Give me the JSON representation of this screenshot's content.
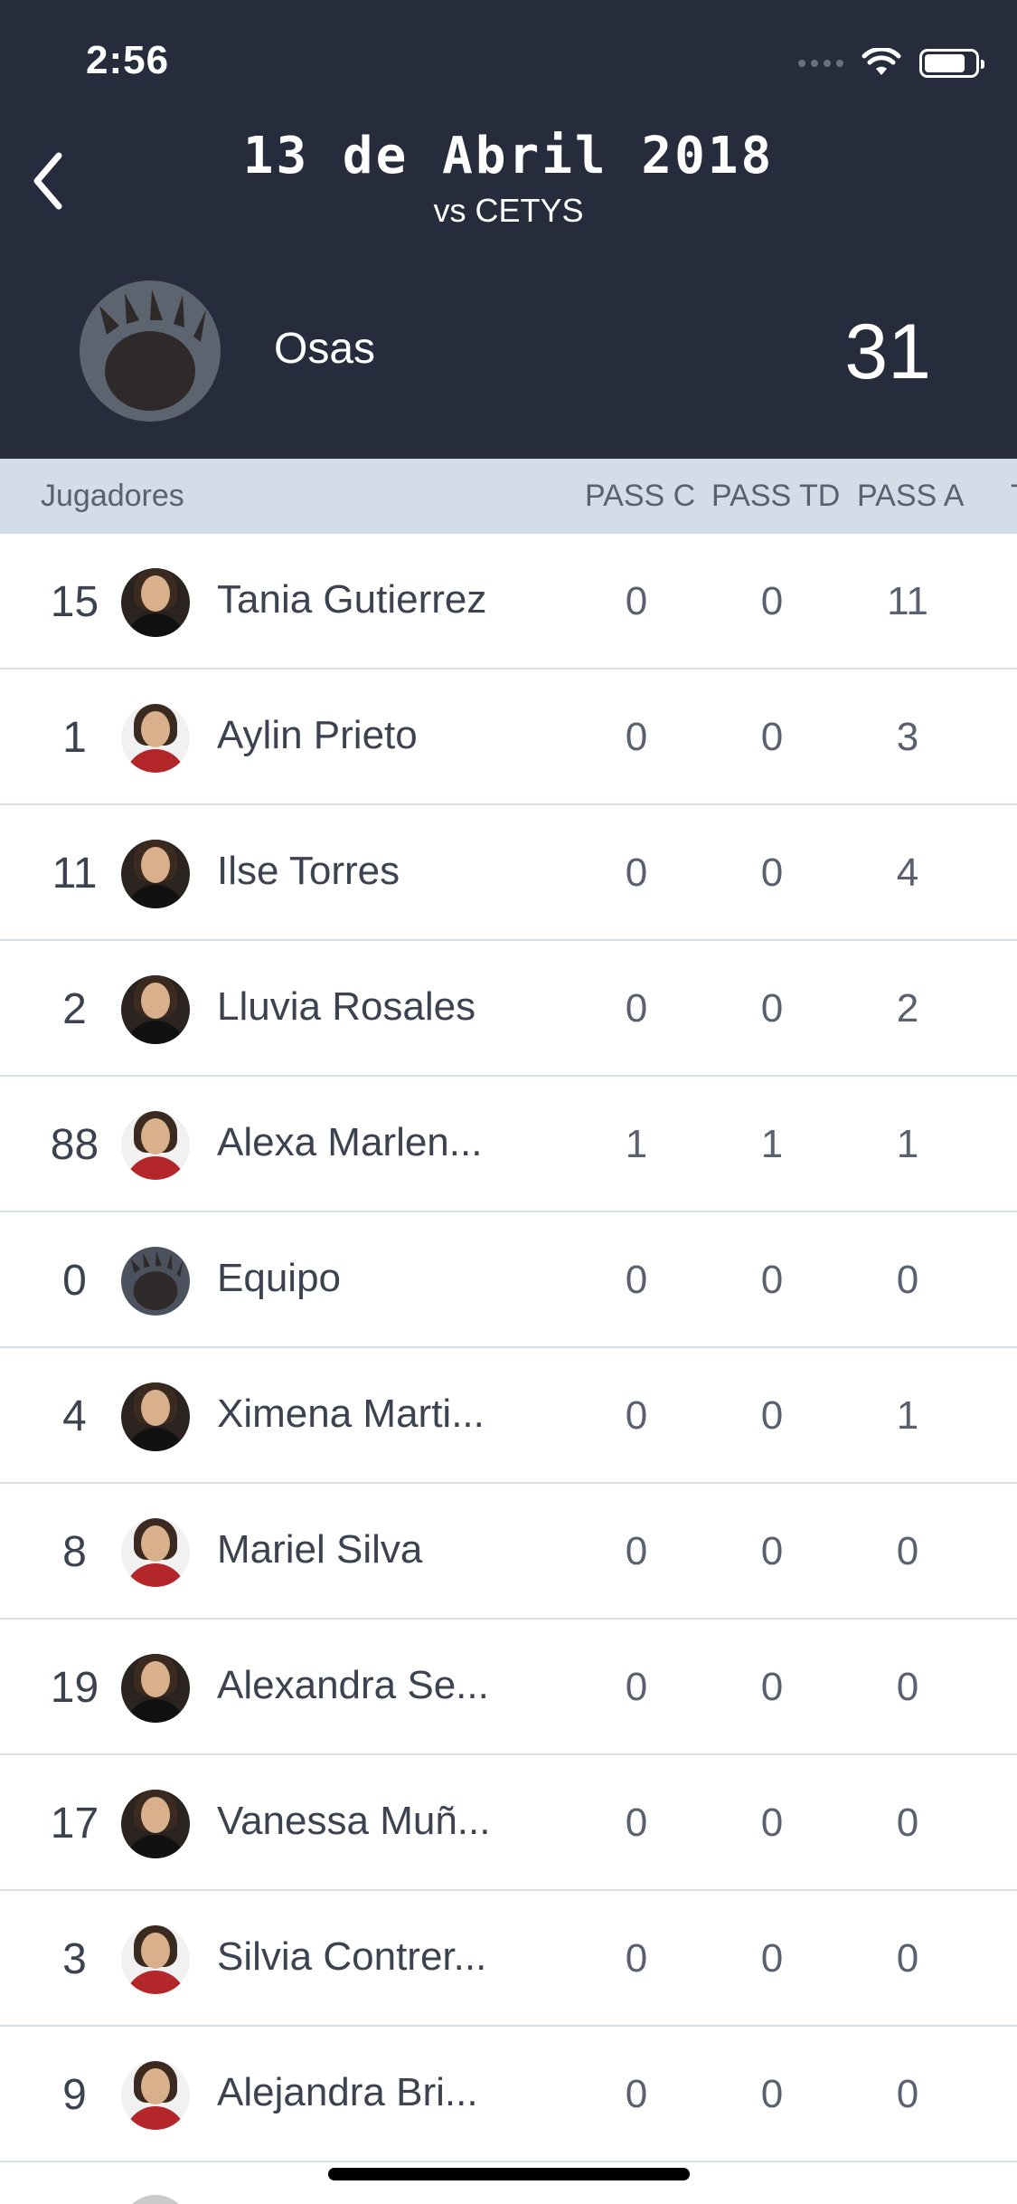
{
  "status_bar": {
    "time": "2:56"
  },
  "header": {
    "title": "13 de Abril 2018",
    "subtitle": "vs CETYS",
    "team_name": "Osas",
    "team_score": "31",
    "colors": {
      "background": "#262c3b",
      "text": "#ffffff"
    },
    "icons": {
      "back": "chevron-left-icon",
      "team_logo": "bear-paw-icon"
    }
  },
  "columns": {
    "players": "Jugadores",
    "pass_c": "PASS C",
    "pass_td": "PASS TD",
    "pass_a": "PASS A",
    "more": "T"
  },
  "players": [
    {
      "number": "15",
      "name": "Tania Gutierrez",
      "pass_c": "0",
      "pass_td": "0",
      "pass_a": "11"
    },
    {
      "number": "1",
      "name": "Aylin Prieto",
      "pass_c": "0",
      "pass_td": "0",
      "pass_a": "3"
    },
    {
      "number": "11",
      "name": "Ilse Torres",
      "pass_c": "0",
      "pass_td": "0",
      "pass_a": "4"
    },
    {
      "number": "2",
      "name": "Lluvia Rosales",
      "pass_c": "0",
      "pass_td": "0",
      "pass_a": "2"
    },
    {
      "number": "88",
      "name": "Alexa Marlen...",
      "pass_c": "1",
      "pass_td": "1",
      "pass_a": "1"
    },
    {
      "number": "0",
      "name": "Equipo",
      "pass_c": "0",
      "pass_td": "0",
      "pass_a": "0"
    },
    {
      "number": "4",
      "name": "Ximena Marti...",
      "pass_c": "0",
      "pass_td": "0",
      "pass_a": "1"
    },
    {
      "number": "8",
      "name": "Mariel  Silva",
      "pass_c": "0",
      "pass_td": "0",
      "pass_a": "0"
    },
    {
      "number": "19",
      "name": "Alexandra Se...",
      "pass_c": "0",
      "pass_td": "0",
      "pass_a": "0"
    },
    {
      "number": "17",
      "name": "Vanessa Muñ...",
      "pass_c": "0",
      "pass_td": "0",
      "pass_a": "0"
    },
    {
      "number": "3",
      "name": "Silvia Contrer...",
      "pass_c": "0",
      "pass_td": "0",
      "pass_a": "0"
    },
    {
      "number": "9",
      "name": "Alejandra  Bri...",
      "pass_c": "0",
      "pass_td": "0",
      "pass_a": "0"
    }
  ]
}
